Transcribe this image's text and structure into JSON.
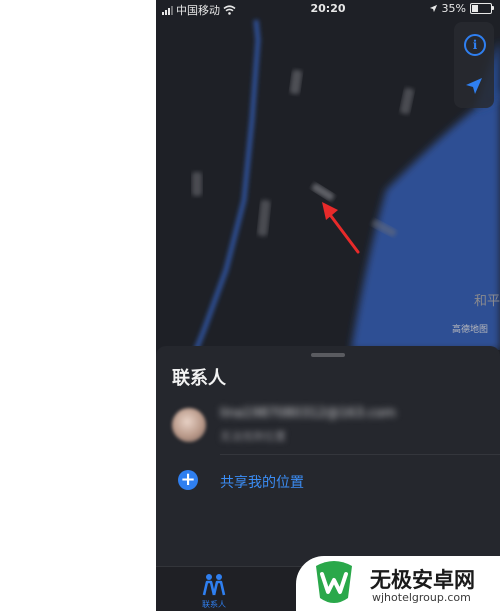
{
  "status_bar": {
    "carrier": "中国移动",
    "time": "20:20",
    "battery": "35%",
    "battery_level": 0.35,
    "icons": [
      "signal-icon",
      "wifi-icon",
      "location-arrow-icon",
      "battery-icon"
    ]
  },
  "map": {
    "place_label": "和平",
    "legal_text": "高德地图",
    "controls": {
      "info_icon": "i",
      "locate_icon": "location-arrow-icon"
    }
  },
  "sheet": {
    "title": "联系人",
    "contact": {
      "email": "lina1987080312@163.com",
      "status": "无法找到位置"
    },
    "share_location": {
      "icon": "+",
      "label": "共享我的位置"
    }
  },
  "tab_bar": {
    "tabs": [
      {
        "label": "联系人",
        "icon": "people-icon",
        "selected": true
      }
    ]
  },
  "watermark": {
    "name": "无极安卓网",
    "url": "wjhotelgroup.com"
  },
  "colors": {
    "accent": "#2f7ff0",
    "map_background": "#1e2026",
    "road": "#2d4f94",
    "sheet_background": "#25272d",
    "arrow_annotation": "#e82a2a",
    "watermark_green": "#2aa84a"
  }
}
